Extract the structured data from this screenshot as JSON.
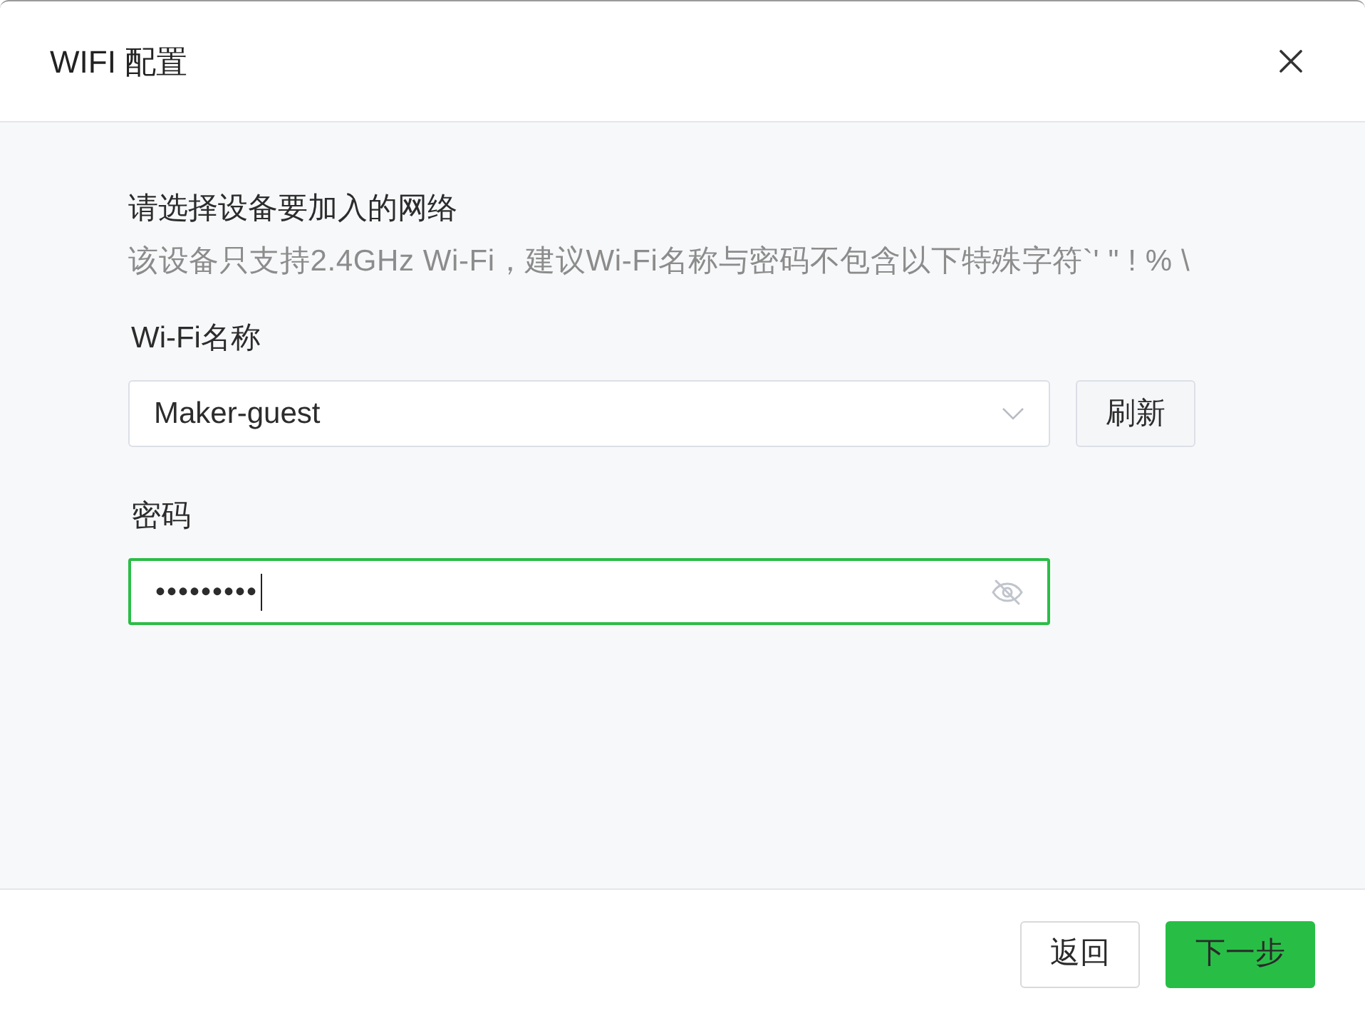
{
  "window": {
    "title": "WIFI 配置"
  },
  "intro": {
    "heading": "请选择设备要加入的网络",
    "hint": "该设备只支持2.4GHz Wi-Fi，建议Wi-Fi名称与密码不包含以下特殊字符`' \" ! % \\"
  },
  "fields": [
    {
      "kind": "select",
      "label": "Wi-Fi名称",
      "value": "Maker-guest",
      "button": "刷新",
      "focused": false
    },
    {
      "kind": "password",
      "label": "密码",
      "value": "•••••••••",
      "focused": true
    }
  ],
  "buttons": [
    {
      "label": "返回",
      "kind": "secondary"
    },
    {
      "label": "下一步",
      "kind": "primary"
    }
  ]
}
